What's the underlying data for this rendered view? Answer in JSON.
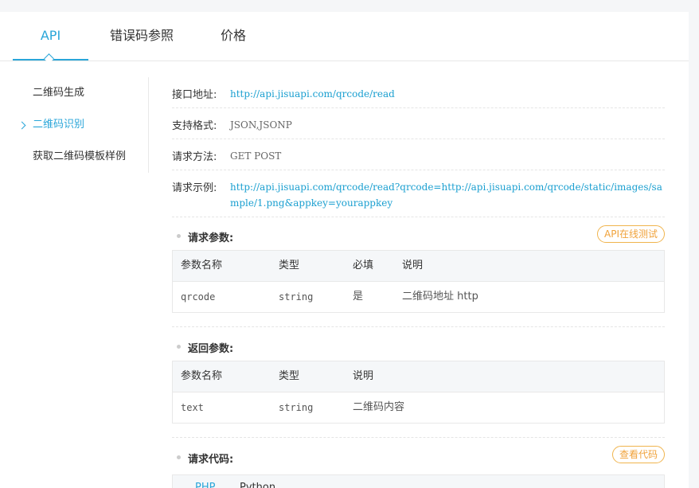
{
  "tabs": [
    {
      "label": "API",
      "active": true
    },
    {
      "label": "错误码参照",
      "active": false
    },
    {
      "label": "价格",
      "active": false
    }
  ],
  "sidebar": {
    "items": [
      {
        "label": "二维码生成",
        "active": false
      },
      {
        "label": "二维码识别",
        "active": true
      },
      {
        "label": "获取二维码模板样例",
        "active": false
      }
    ]
  },
  "info": {
    "endpoint_label": "接口地址:",
    "endpoint_value": "http://api.jisuapi.com/qrcode/read",
    "format_label": "支持格式:",
    "format_value": "JSON,JSONP",
    "method_label": "请求方法:",
    "method_value": "GET POST",
    "example_label": "请求示例:",
    "example_value": "http://api.jisuapi.com/qrcode/read?qrcode=http://api.jisuapi.com/qrcode/static/images/sample/1.png&appkey=yourappkey"
  },
  "request_params": {
    "title": "请求参数:",
    "test_button": "API在线测试",
    "headers": [
      "参数名称",
      "类型",
      "必填",
      "说明"
    ],
    "rows": [
      [
        "qrcode",
        "string",
        "是",
        "二维码地址 http"
      ]
    ]
  },
  "response_params": {
    "title": "返回参数:",
    "headers": [
      "参数名称",
      "类型",
      "说明"
    ],
    "rows": [
      [
        "text",
        "string",
        "二维码内容"
      ]
    ]
  },
  "request_code": {
    "title": "请求代码:",
    "view_button": "查看代码",
    "tabs": [
      "PHP",
      "Python",
      "...."
    ]
  },
  "colors": {
    "accent": "#2aa6d9",
    "link": "#1a9fd0",
    "pill": "#f0a23a"
  }
}
